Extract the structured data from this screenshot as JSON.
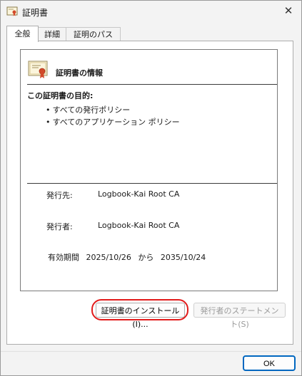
{
  "window": {
    "title": "証明書",
    "close_glyph": "✕"
  },
  "tabs": [
    {
      "label": "全般",
      "active": true
    },
    {
      "label": "詳細",
      "active": false
    },
    {
      "label": "証明のパス",
      "active": false
    }
  ],
  "general": {
    "info_title": "証明書の情報",
    "purpose_heading": "この証明書の目的:",
    "purposes": [
      "すべての発行ポリシー",
      "すべてのアプリケーション ポリシー"
    ],
    "issued_to_label": "発行先:",
    "issued_to_value": "Logbook-Kai Root CA",
    "issued_by_label": "発行者:",
    "issued_by_value": "Logbook-Kai Root CA",
    "validity_label": "有効期間",
    "valid_from": "2025/10/26",
    "validity_connector": "から",
    "valid_to": "2035/10/24"
  },
  "buttons": {
    "install": "証明書のインストール(I)...",
    "issuer_statement": "発行者のステートメント(S)",
    "ok": "OK"
  },
  "icons": {
    "app": "certificate-icon",
    "cert": "certificate-icon",
    "close": "close-icon"
  },
  "colors": {
    "highlight": "#e21b1b",
    "ok_border": "#0067c0"
  }
}
